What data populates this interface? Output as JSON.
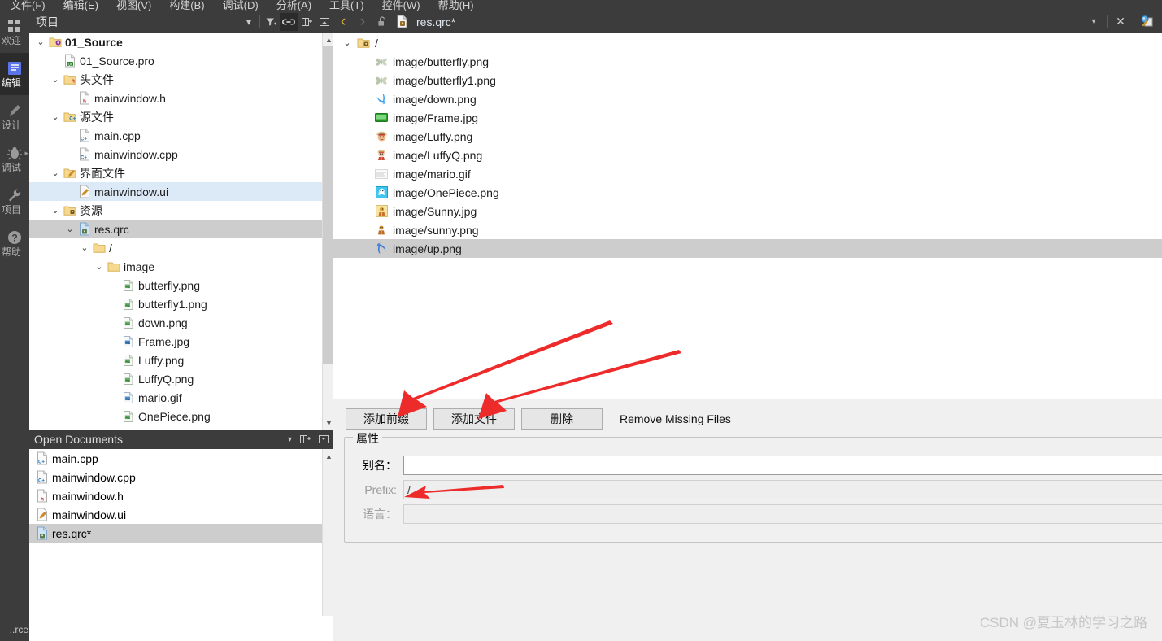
{
  "menubar": {
    "items": [
      "文件(F)",
      "编辑(E)",
      "视图(V)",
      "构建(B)",
      "调试(D)",
      "分析(A)",
      "工具(T)",
      "控件(W)",
      "帮助(H)"
    ]
  },
  "modebar": {
    "items": [
      {
        "label": "欢迎",
        "icon": "grid-icon",
        "active": false
      },
      {
        "label": "编辑",
        "icon": "edit-document-icon",
        "active": true
      },
      {
        "label": "设计",
        "icon": "pencil-ruler-icon",
        "active": false
      },
      {
        "label": "调试",
        "icon": "bug-icon",
        "active": false
      },
      {
        "label": "项目",
        "icon": "wrench-icon",
        "active": false
      },
      {
        "label": "帮助",
        "icon": "question-mark-icon",
        "active": false
      }
    ],
    "bottom_label": "..rce"
  },
  "nav_header": {
    "title": "项目",
    "dropdown": "▾",
    "filter_icon": "filter-icon",
    "link_icon": "link-icon",
    "split_icon": "split-add-icon",
    "close_icon": "collapse-icon"
  },
  "editor_toolbar": {
    "back": "‹",
    "forward": "›",
    "lock_icon": "unlock-icon",
    "file_icon": "qrc-file-icon",
    "filename": "res.qrc*",
    "dropdown": "▾",
    "close": "✕",
    "split_icon": "split-editor-icon"
  },
  "project_tree": {
    "rows": [
      {
        "indent": 0,
        "chev": "⌄",
        "icon": "project-folder-icon",
        "label": "01_Source",
        "bold": true,
        "sel": ""
      },
      {
        "indent": 1,
        "chev": "",
        "icon": "pro-file-icon",
        "label": "01_Source.pro",
        "bold": false,
        "sel": ""
      },
      {
        "indent": 1,
        "chev": "⌄",
        "icon": "headers-folder-icon",
        "label": "头文件",
        "bold": false,
        "sel": ""
      },
      {
        "indent": 2,
        "chev": "",
        "icon": "h-file-icon",
        "label": "mainwindow.h",
        "bold": false,
        "sel": ""
      },
      {
        "indent": 1,
        "chev": "⌄",
        "icon": "sources-folder-icon",
        "label": "源文件",
        "bold": false,
        "sel": ""
      },
      {
        "indent": 2,
        "chev": "",
        "icon": "cpp-file-icon",
        "label": "main.cpp",
        "bold": false,
        "sel": ""
      },
      {
        "indent": 2,
        "chev": "",
        "icon": "cpp-file-icon",
        "label": "mainwindow.cpp",
        "bold": false,
        "sel": ""
      },
      {
        "indent": 1,
        "chev": "⌄",
        "icon": "forms-folder-icon",
        "label": "界面文件",
        "bold": false,
        "sel": ""
      },
      {
        "indent": 2,
        "chev": "",
        "icon": "ui-file-icon",
        "label": "mainwindow.ui",
        "bold": false,
        "sel": "sel-blue"
      },
      {
        "indent": 1,
        "chev": "⌄",
        "icon": "resources-folder-icon",
        "label": "资源",
        "bold": false,
        "sel": ""
      },
      {
        "indent": 2,
        "chev": "⌄",
        "icon": "qrc-file-icon",
        "label": "res.qrc",
        "bold": false,
        "sel": "sel-grey"
      },
      {
        "indent": 3,
        "chev": "⌄",
        "icon": "folder-icon",
        "label": "/",
        "bold": false,
        "sel": ""
      },
      {
        "indent": 4,
        "chev": "⌄",
        "icon": "folder-icon",
        "label": "image",
        "bold": false,
        "sel": ""
      },
      {
        "indent": 5,
        "chev": "",
        "icon": "png-file-icon",
        "label": "butterfly.png",
        "bold": false,
        "sel": ""
      },
      {
        "indent": 5,
        "chev": "",
        "icon": "png-file-icon",
        "label": "butterfly1.png",
        "bold": false,
        "sel": ""
      },
      {
        "indent": 5,
        "chev": "",
        "icon": "png-file-icon",
        "label": "down.png",
        "bold": false,
        "sel": ""
      },
      {
        "indent": 5,
        "chev": "",
        "icon": "jpg-file-icon",
        "label": "Frame.jpg",
        "bold": false,
        "sel": ""
      },
      {
        "indent": 5,
        "chev": "",
        "icon": "png-file-icon",
        "label": "Luffy.png",
        "bold": false,
        "sel": ""
      },
      {
        "indent": 5,
        "chev": "",
        "icon": "png-file-icon",
        "label": "LuffyQ.png",
        "bold": false,
        "sel": ""
      },
      {
        "indent": 5,
        "chev": "",
        "icon": "gif-file-icon",
        "label": "mario.gif",
        "bold": false,
        "sel": ""
      },
      {
        "indent": 5,
        "chev": "",
        "icon": "png-file-icon",
        "label": "OnePiece.png",
        "bold": false,
        "sel": ""
      }
    ]
  },
  "open_documents": {
    "title": "Open Documents",
    "dropdown": "▾",
    "split_icon": "split-add-icon",
    "close_icon": "collapse-icon",
    "rows": [
      {
        "icon": "cpp-file-icon",
        "label": "main.cpp",
        "sel": false
      },
      {
        "icon": "cpp-file-icon",
        "label": "mainwindow.cpp",
        "sel": false
      },
      {
        "icon": "h-file-icon",
        "label": "mainwindow.h",
        "sel": false
      },
      {
        "icon": "ui-file-icon",
        "label": "mainwindow.ui",
        "sel": false
      },
      {
        "icon": "qrc-file-icon",
        "label": "res.qrc*",
        "sel": true
      }
    ]
  },
  "resource_list": {
    "root": {
      "chev": "⌄",
      "icon": "qrc-folder-icon",
      "label": "/"
    },
    "items": [
      {
        "icon": "butterfly-thumb",
        "label": "image/butterfly.png",
        "sel": false
      },
      {
        "icon": "butterfly-thumb",
        "label": "image/butterfly1.png",
        "sel": false
      },
      {
        "icon": "down-arrow-thumb",
        "label": "image/down.png",
        "sel": false
      },
      {
        "icon": "frame-thumb",
        "label": "image/Frame.jpg",
        "sel": false
      },
      {
        "icon": "luffy-thumb",
        "label": "image/Luffy.png",
        "sel": false
      },
      {
        "icon": "luffyq-thumb",
        "label": "image/LuffyQ.png",
        "sel": false
      },
      {
        "icon": "mario-thumb",
        "label": "image/mario.gif",
        "sel": false
      },
      {
        "icon": "onepiece-thumb",
        "label": "image/OnePiece.png",
        "sel": false
      },
      {
        "icon": "sunny-jpg-thumb",
        "label": "image/Sunny.jpg",
        "sel": false
      },
      {
        "icon": "sunny-png-thumb",
        "label": "image/sunny.png",
        "sel": false
      },
      {
        "icon": "up-arrow-thumb",
        "label": "image/up.png",
        "sel": true
      }
    ]
  },
  "resource_panel": {
    "buttons": [
      {
        "label": "添加前缀",
        "flat": false
      },
      {
        "label": "添加文件",
        "flat": false
      },
      {
        "label": "删除",
        "flat": false
      },
      {
        "label": "Remove Missing Files",
        "flat": true
      }
    ],
    "group_title": "属性",
    "fields": [
      {
        "label": "别名：",
        "value": "",
        "disabled": false
      },
      {
        "label": "Prefix:",
        "value": "/",
        "disabled": true
      },
      {
        "label": "语言：",
        "value": "",
        "disabled": true
      }
    ]
  },
  "watermark": "CSDN @夏玉林的学习之路",
  "colors": {
    "dark_chrome": "#3c3c3c",
    "dark_active": "#2b2b2b",
    "selection_blue": "#dceaf7",
    "selection_grey": "#cdcdcd",
    "panel_bg": "#f0f0f0",
    "annotation_red": "#ee2b2b",
    "link_active_text": "#dfe6ef"
  }
}
